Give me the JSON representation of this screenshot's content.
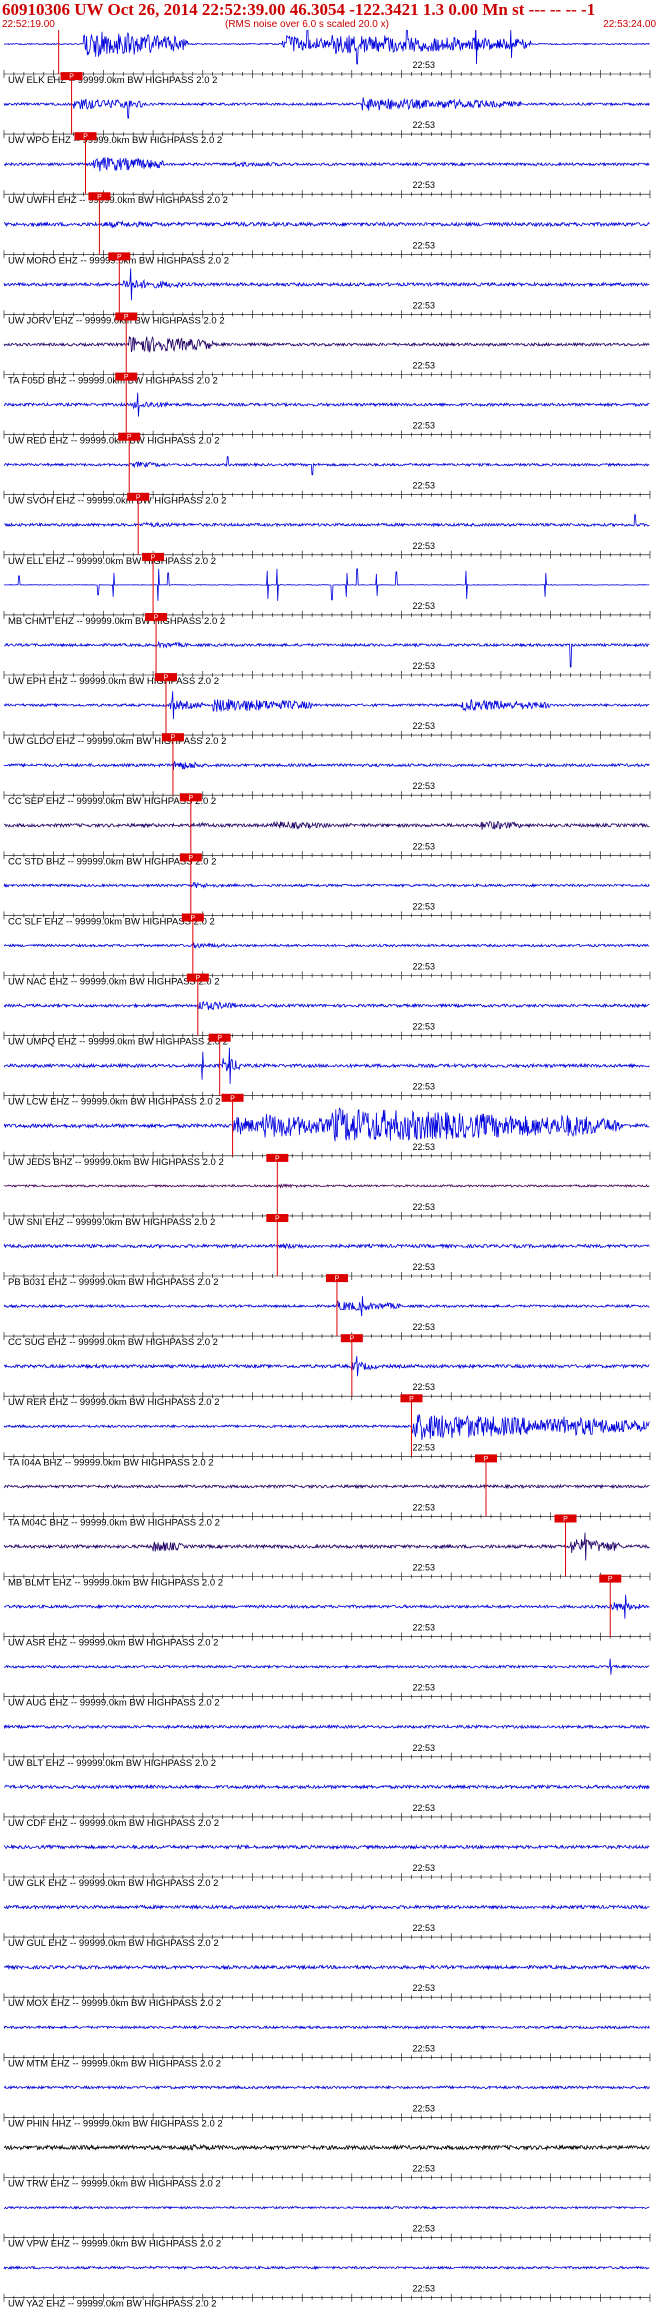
{
  "header": {
    "title": "60910306 UW Oct 26, 2014 22:52:39.00   46.3054 -122.3421  1.3 0.00 Mn st --- -- --  -1",
    "start_time": "22:52:19.00",
    "note": "(RMS noise over 6.0 s scaled 20.0 x)",
    "end_time": "22:53:24.00"
  },
  "chart_data": {
    "type": "line",
    "title": "60910306 UW Oct 26, 2014 22:52:39.00   46.3054 -122.3421  1.3 0.00 Mn st --- -- --  -1",
    "x_range": [
      "22:52:19.00",
      "22:53:24.00"
    ],
    "minute_label": "22:53",
    "minute_tick_seconds": 41,
    "total_seconds": 65,
    "series": [
      {
        "name": "UW ELK EHZ -- 99999.0km BW  HIGHPASS  2.0  2",
        "color": "#0000dd",
        "pick_s": 5.5,
        "pick_label": "P",
        "amp": 0.6,
        "events": [
          [
            8.0,
            18.5,
            14
          ],
          [
            28.0,
            33.0,
            9
          ],
          [
            33.0,
            53.0,
            10
          ]
        ],
        "spikes": [
          [
            30.5,
            18
          ],
          [
            35.5,
            20
          ],
          [
            40.5,
            19
          ],
          [
            47.5,
            20
          ],
          [
            51.0,
            14
          ]
        ]
      },
      {
        "name": "UW WPO EHZ -- 99999.0km BW  HIGHPASS  2.0  2",
        "color": "#0000dd",
        "pick_s": 6.8,
        "pick_label": "P",
        "amp": 1.2,
        "events": [
          [
            7.0,
            14.0,
            6
          ],
          [
            36.0,
            44.0,
            7
          ],
          [
            44.0,
            52.0,
            5
          ]
        ],
        "spikes": [
          [
            12.5,
            14
          ]
        ]
      },
      {
        "name": "UW UWFH EHZ -- 99999.0km BW  HIGHPASS  2.0  2",
        "color": "#0000dd",
        "pick_s": 8.2,
        "pick_label": "P",
        "amp": 1.3,
        "events": [
          [
            9.0,
            16.0,
            8
          ],
          [
            23.0,
            30.0,
            2.5
          ]
        ],
        "spikes": []
      },
      {
        "name": "UW MORO EHZ -- 99999.0km BW  HIGHPASS  2.0  2",
        "color": "#0000dd",
        "pick_s": 9.6,
        "pick_label": "P",
        "amp": 1.8,
        "events": [
          [
            10.0,
            20.0,
            3
          ],
          [
            22.0,
            44.0,
            2.2
          ]
        ],
        "spikes": []
      },
      {
        "name": "UW JORV EHZ -- 99999.0km BW  HIGHPASS  2.0  2",
        "color": "#0000dd",
        "pick_s": 11.6,
        "pick_label": "P",
        "amp": 1.6,
        "events": [
          [
            12.0,
            18.0,
            5
          ]
        ],
        "spikes": [
          [
            12.8,
            16
          ]
        ]
      },
      {
        "name": "TA F05D BHZ -- 99999.0km BW  HIGHPASS  2.0  2",
        "color": "#220066",
        "pick_s": 12.3,
        "pick_label": "P",
        "amp": 1.4,
        "events": [
          [
            12.5,
            21.0,
            9
          ]
        ],
        "spikes": []
      },
      {
        "name": "UW RED EHZ -- 99999.0km BW  HIGHPASS  2.0  2",
        "color": "#0000dd",
        "pick_s": 12.3,
        "pick_label": "P",
        "amp": 1.4,
        "events": [
          [
            13.0,
            17.0,
            4
          ]
        ],
        "spikes": [
          [
            13.5,
            12
          ]
        ]
      },
      {
        "name": "UW SVOH EHZ -- 99999.0km BW  HIGHPASS  2.0  2",
        "color": "#0000dd",
        "pick_s": 12.6,
        "pick_label": "P",
        "amp": 1.2,
        "events": [
          [
            13.0,
            16.5,
            3
          ]
        ],
        "spikes": [
          [
            22.5,
            8
          ],
          [
            31.0,
            10
          ]
        ]
      },
      {
        "name": "UW ELL EHZ -- 99999.0km BW  HIGHPASS  2.0  2",
        "color": "#0000dd",
        "pick_s": 13.5,
        "pick_label": "P",
        "amp": 1.4,
        "events": [
          [
            14.0,
            19.0,
            2.5
          ]
        ],
        "spikes": [
          [
            63.5,
            10
          ]
        ]
      },
      {
        "name": "MB CHMT EHZ -- 99999.0km BW  HIGHPASS  2.0  2",
        "color": "#0000dd",
        "pick_s": 15.0,
        "pick_label": "P",
        "amp": 0.3,
        "events": [],
        "spikes": [
          [
            1.5,
            9
          ],
          [
            9.5,
            10
          ],
          [
            11.0,
            12
          ],
          [
            15.5,
            16
          ],
          [
            16.5,
            12
          ],
          [
            26.5,
            14
          ],
          [
            27.5,
            16
          ],
          [
            33.0,
            15
          ],
          [
            34.5,
            12
          ],
          [
            35.5,
            16
          ],
          [
            37.5,
            11
          ],
          [
            39.5,
            13
          ],
          [
            46.5,
            14
          ],
          [
            54.5,
            12
          ]
        ]
      },
      {
        "name": "UW EPH EHZ -- 99999.0km BW  HIGHPASS  2.0  2",
        "color": "#0000dd",
        "pick_s": 15.3,
        "pick_label": "P",
        "amp": 1.3,
        "events": [
          [
            15.5,
            19.0,
            3
          ]
        ],
        "spikes": [
          [
            57.0,
            -22
          ]
        ]
      },
      {
        "name": "UW GLDO EHZ -- 99999.0km BW  HIGHPASS  2.0  2",
        "color": "#0000dd",
        "pick_s": 16.3,
        "pick_label": "P",
        "amp": 1.2,
        "events": [
          [
            16.5,
            20.0,
            5
          ],
          [
            21.0,
            31.0,
            7
          ],
          [
            46.0,
            55.0,
            6
          ]
        ],
        "spikes": [
          [
            17.0,
            14
          ]
        ]
      },
      {
        "name": "CC SEP EHZ -- 99999.0km BW  HIGHPASS  2.0  2",
        "color": "#0000dd",
        "pick_s": 17.0,
        "pick_label": "P",
        "amp": 1.4,
        "events": [
          [
            17.0,
            20.0,
            5
          ]
        ],
        "spikes": []
      },
      {
        "name": "CC STD BHZ -- 99999.0km BW  HIGHPASS  2.0  2",
        "color": "#220066",
        "pick_s": 18.8,
        "pick_label": "P",
        "amp": 1.6,
        "events": [
          [
            19.0,
            22.0,
            3
          ],
          [
            27.0,
            33.0,
            4
          ],
          [
            48.0,
            52.0,
            5
          ]
        ],
        "spikes": []
      },
      {
        "name": "CC SLF EHZ -- 99999.0km BW  HIGHPASS  2.0  2",
        "color": "#0000dd",
        "pick_s": 18.8,
        "pick_label": "P",
        "amp": 1.2,
        "events": [
          [
            19.0,
            22.0,
            3
          ]
        ],
        "spikes": []
      },
      {
        "name": "UW NAC EHZ -- 99999.0km BW  HIGHPASS  2.0  2",
        "color": "#0000dd",
        "pick_s": 19.0,
        "pick_label": "P",
        "amp": 1.2,
        "events": [
          [
            19.0,
            22.5,
            3
          ]
        ],
        "spikes": []
      },
      {
        "name": "UW UMPQ EHZ -- 99999.0km BW  HIGHPASS  2.0  2",
        "color": "#0000dd",
        "pick_s": 19.5,
        "pick_label": "P",
        "amp": 1.4,
        "events": [
          [
            19.5,
            23.5,
            5
          ]
        ],
        "spikes": []
      },
      {
        "name": "UW LCW EHZ -- 99999.0km BW  HIGHPASS  2.0  2",
        "color": "#0000dd",
        "pick_s": 21.7,
        "pick_label": "P",
        "amp": 1.6,
        "events": [
          [
            22.0,
            24.0,
            8
          ]
        ],
        "spikes": [
          [
            20.0,
            14
          ],
          [
            22.7,
            18
          ]
        ]
      },
      {
        "name": "UW JEDS BHZ -- 99999.0km BW  HIGHPASS  2.0  2",
        "color": "#0000dd",
        "pick_s": 23.0,
        "pick_label": "P",
        "amp": 1.8,
        "events": [
          [
            23.0,
            26.0,
            10
          ],
          [
            26.0,
            33.0,
            13
          ],
          [
            33.0,
            56.0,
            18
          ],
          [
            56.0,
            62.0,
            12
          ]
        ],
        "spikes": []
      },
      {
        "name": "UW SNI EHZ -- 99999.0km BW  HIGHPASS  2.0  2",
        "color": "#440055",
        "pick_s": 27.5,
        "pick_label": "P",
        "amp": 1.0,
        "events": [
          [
            27.5,
            31.0,
            2
          ]
        ],
        "spikes": []
      },
      {
        "name": "PB B031 EHZ -- 99999.0km BW  HIGHPASS  2.0  2",
        "color": "#0000dd",
        "pick_s": 27.5,
        "pick_label": "P",
        "amp": 1.6,
        "events": [
          [
            28.0,
            31.0,
            3
          ]
        ],
        "spikes": []
      },
      {
        "name": "CC SUG EHZ -- 99999.0km BW  HIGHPASS  2.0  2",
        "color": "#0000dd",
        "pick_s": 33.5,
        "pick_label": "P",
        "amp": 1.2,
        "events": [
          [
            33.5,
            40.0,
            5
          ]
        ],
        "spikes": [
          [
            36.0,
            10
          ]
        ]
      },
      {
        "name": "UW RER EHZ -- 99999.0km BW  HIGHPASS  2.0  2",
        "color": "#0000dd",
        "pick_s": 35.0,
        "pick_label": "P",
        "amp": 1.6,
        "events": [
          [
            35.0,
            37.5,
            5
          ]
        ],
        "spikes": [
          [
            35.5,
            10
          ]
        ]
      },
      {
        "name": "TA I04A BHZ -- 99999.0km BW  HIGHPASS  2.0  2",
        "color": "#0000dd",
        "pick_s": 41.0,
        "pick_label": "P",
        "amp": 1.2,
        "events": [
          [
            41.0,
            56.0,
            14
          ],
          [
            56.0,
            65.0,
            10
          ]
        ],
        "spikes": []
      },
      {
        "name": "TA M04C BHZ -- 99999.0km BW  HIGHPASS  2.0  2",
        "color": "#220066",
        "pick_s": 48.5,
        "pick_label": "P",
        "amp": 1.4,
        "events": [],
        "spikes": []
      },
      {
        "name": "MB BLMT EHZ -- 99999.0km BW  HIGHPASS  2.0  2",
        "color": "#220066",
        "pick_s": 56.5,
        "pick_label": "P",
        "amp": 1.6,
        "events": [
          [
            15.0,
            18.0,
            6
          ],
          [
            57.0,
            62.0,
            8
          ]
        ],
        "spikes": [
          [
            58.5,
            14
          ]
        ]
      },
      {
        "name": "UW ASR EHZ -- 99999.0km BW  HIGHPASS  2.0  2",
        "color": "#0000dd",
        "pick_s": 61.0,
        "pick_label": "P",
        "amp": 1.4,
        "events": [
          [
            61.0,
            64.0,
            5
          ]
        ],
        "spikes": [
          [
            62.5,
            12
          ]
        ]
      },
      {
        "name": "UW AUG EHZ -- 99999.0km BW  HIGHPASS  2.0  2",
        "color": "#0000dd",
        "pick_s": null,
        "pick_label": "",
        "amp": 1.2,
        "events": [],
        "spikes": [
          [
            61.0,
            8
          ]
        ]
      },
      {
        "name": "UW BLT EHZ -- 99999.0km BW  HIGHPASS  2.0  2",
        "color": "#0000dd",
        "pick_s": null,
        "pick_label": "",
        "amp": 1.4,
        "events": [],
        "spikes": []
      },
      {
        "name": "UW CDF EHZ -- 99999.0km BW  HIGHPASS  2.0  2",
        "color": "#0000dd",
        "pick_s": null,
        "pick_label": "",
        "amp": 1.6,
        "events": [],
        "spikes": []
      },
      {
        "name": "UW GLK EHZ -- 99999.0km BW  HIGHPASS  2.0  2",
        "color": "#0000dd",
        "pick_s": null,
        "pick_label": "",
        "amp": 1.6,
        "events": [],
        "spikes": []
      },
      {
        "name": "UW GUL EHZ -- 99999.0km BW  HIGHPASS  2.0  2",
        "color": "#0000dd",
        "pick_s": null,
        "pick_label": "",
        "amp": 1.6,
        "events": [],
        "spikes": []
      },
      {
        "name": "UW MOX EHZ -- 99999.0km BW  HIGHPASS  2.0  2",
        "color": "#0000dd",
        "pick_s": null,
        "pick_label": "",
        "amp": 1.6,
        "events": [],
        "spikes": []
      },
      {
        "name": "UW MTM EHZ -- 99999.0km BW  HIGHPASS  2.0  2",
        "color": "#0000dd",
        "pick_s": null,
        "pick_label": "",
        "amp": 1.2,
        "events": [],
        "spikes": []
      },
      {
        "name": "UW PHIN HHZ -- 99999.0km BW  HIGHPASS  2.0  2",
        "color": "#0000dd",
        "pick_s": null,
        "pick_label": "",
        "amp": 1.3,
        "events": [],
        "spikes": []
      },
      {
        "name": "UW TRW EHZ -- 99999.0km BW  HIGHPASS  2.0  2",
        "color": "#000000",
        "pick_s": null,
        "pick_label": "",
        "amp": 2.0,
        "events": [
          [
            18.0,
            26.0,
            3
          ]
        ],
        "spikes": []
      },
      {
        "name": "UW VPW EHZ -- 99999.0km BW  HIGHPASS  2.0  2",
        "color": "#0000dd",
        "pick_s": null,
        "pick_label": "",
        "amp": 1.0,
        "events": [],
        "spikes": []
      },
      {
        "name": "UW YA2 EHZ -- 99999.0km BW  HIGHPASS  2.0  2",
        "color": "#0000dd",
        "pick_s": null,
        "pick_label": "",
        "amp": 1.2,
        "events": [],
        "spikes": []
      }
    ]
  }
}
